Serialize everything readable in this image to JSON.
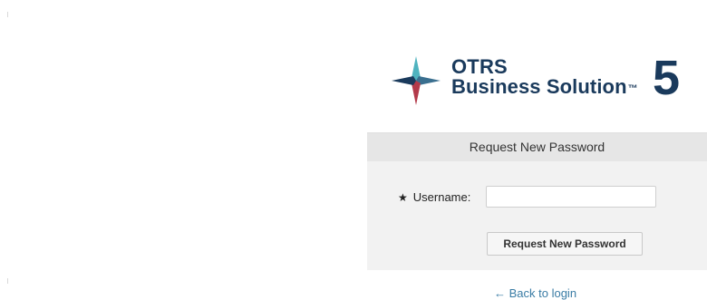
{
  "logo": {
    "line1": "OTRS",
    "line2": "Business Solution",
    "tm": "™",
    "version": "5",
    "colors": {
      "navy": "#1a3a5c",
      "teal": "#4fb3bf",
      "red": "#b33a4a"
    }
  },
  "form": {
    "title": "Request New Password",
    "required_marker": "★",
    "username_label": "Username:",
    "username_value": "",
    "submit_label": "Request New Password"
  },
  "links": {
    "back_to_login": "← Back to login"
  }
}
